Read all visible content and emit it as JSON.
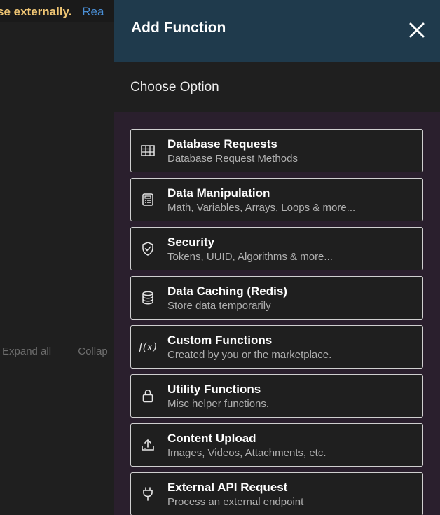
{
  "background": {
    "banner_strong": "se externally.",
    "banner_link": "Rea",
    "expand_all": "Expand all",
    "collapse": "Collap"
  },
  "drawer": {
    "title": "Add Function",
    "section_title": "Choose Option",
    "options": [
      {
        "title": "Database Requests",
        "desc": "Database Request Methods",
        "icon": "table-icon"
      },
      {
        "title": "Data Manipulation",
        "desc": "Math, Variables, Arrays, Loops & more...",
        "icon": "calculator-icon"
      },
      {
        "title": "Security",
        "desc": "Tokens, UUID, Algorithms & more...",
        "icon": "shield-check-icon"
      },
      {
        "title": "Data Caching (Redis)",
        "desc": "Store data temporarily",
        "icon": "database-icon"
      },
      {
        "title": "Custom Functions",
        "desc": "Created by you or the marketplace.",
        "icon": "function-icon"
      },
      {
        "title": "Utility Functions",
        "desc": "Misc helper functions.",
        "icon": "lock-icon"
      },
      {
        "title": "Content Upload",
        "desc": "Images, Videos, Attachments, etc.",
        "icon": "upload-icon"
      },
      {
        "title": "External API Request",
        "desc": "Process an external endpoint",
        "icon": "plug-icon"
      }
    ],
    "fx_glyph": "f(x)"
  },
  "colors": {
    "header_bg": "#1f3a4c",
    "drawer_bg": "#2a1f2d",
    "card_bg": "#1f1f1f",
    "card_border": "#cfcfcf",
    "banner_text": "#f0c674",
    "link": "#4a8fd6"
  }
}
